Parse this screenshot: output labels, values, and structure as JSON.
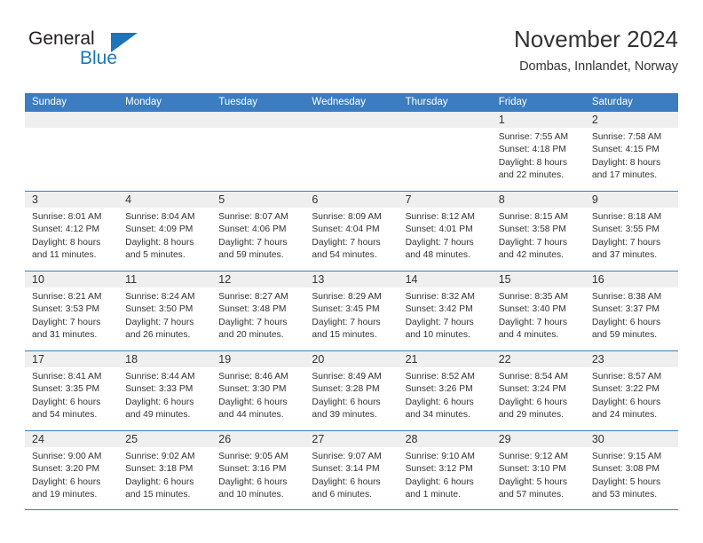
{
  "logo": {
    "primary_text": "General",
    "secondary_text": "Blue",
    "primary_color": "#231f20",
    "accent_color": "#1b75bb"
  },
  "header": {
    "title": "November 2024",
    "subtitle": "Dombas, Innlandet, Norway"
  },
  "theme": {
    "header_band_color": "#3b7dc0",
    "day_band_color": "#efefef",
    "text_color": "#333333"
  },
  "weekday_headers": [
    "Sunday",
    "Monday",
    "Tuesday",
    "Wednesday",
    "Thursday",
    "Friday",
    "Saturday"
  ],
  "weeks": [
    {
      "days": [
        {
          "num": "",
          "empty": true,
          "sunrise": "",
          "sunset": "",
          "daylight1": "",
          "daylight2": ""
        },
        {
          "num": "",
          "empty": true,
          "sunrise": "",
          "sunset": "",
          "daylight1": "",
          "daylight2": ""
        },
        {
          "num": "",
          "empty": true,
          "sunrise": "",
          "sunset": "",
          "daylight1": "",
          "daylight2": ""
        },
        {
          "num": "",
          "empty": true,
          "sunrise": "",
          "sunset": "",
          "daylight1": "",
          "daylight2": ""
        },
        {
          "num": "",
          "empty": true,
          "sunrise": "",
          "sunset": "",
          "daylight1": "",
          "daylight2": ""
        },
        {
          "num": "1",
          "empty": false,
          "sunrise": "Sunrise: 7:55 AM",
          "sunset": "Sunset: 4:18 PM",
          "daylight1": "Daylight: 8 hours",
          "daylight2": "and 22 minutes."
        },
        {
          "num": "2",
          "empty": false,
          "sunrise": "Sunrise: 7:58 AM",
          "sunset": "Sunset: 4:15 PM",
          "daylight1": "Daylight: 8 hours",
          "daylight2": "and 17 minutes."
        }
      ]
    },
    {
      "days": [
        {
          "num": "3",
          "empty": false,
          "sunrise": "Sunrise: 8:01 AM",
          "sunset": "Sunset: 4:12 PM",
          "daylight1": "Daylight: 8 hours",
          "daylight2": "and 11 minutes."
        },
        {
          "num": "4",
          "empty": false,
          "sunrise": "Sunrise: 8:04 AM",
          "sunset": "Sunset: 4:09 PM",
          "daylight1": "Daylight: 8 hours",
          "daylight2": "and 5 minutes."
        },
        {
          "num": "5",
          "empty": false,
          "sunrise": "Sunrise: 8:07 AM",
          "sunset": "Sunset: 4:06 PM",
          "daylight1": "Daylight: 7 hours",
          "daylight2": "and 59 minutes."
        },
        {
          "num": "6",
          "empty": false,
          "sunrise": "Sunrise: 8:09 AM",
          "sunset": "Sunset: 4:04 PM",
          "daylight1": "Daylight: 7 hours",
          "daylight2": "and 54 minutes."
        },
        {
          "num": "7",
          "empty": false,
          "sunrise": "Sunrise: 8:12 AM",
          "sunset": "Sunset: 4:01 PM",
          "daylight1": "Daylight: 7 hours",
          "daylight2": "and 48 minutes."
        },
        {
          "num": "8",
          "empty": false,
          "sunrise": "Sunrise: 8:15 AM",
          "sunset": "Sunset: 3:58 PM",
          "daylight1": "Daylight: 7 hours",
          "daylight2": "and 42 minutes."
        },
        {
          "num": "9",
          "empty": false,
          "sunrise": "Sunrise: 8:18 AM",
          "sunset": "Sunset: 3:55 PM",
          "daylight1": "Daylight: 7 hours",
          "daylight2": "and 37 minutes."
        }
      ]
    },
    {
      "days": [
        {
          "num": "10",
          "empty": false,
          "sunrise": "Sunrise: 8:21 AM",
          "sunset": "Sunset: 3:53 PM",
          "daylight1": "Daylight: 7 hours",
          "daylight2": "and 31 minutes."
        },
        {
          "num": "11",
          "empty": false,
          "sunrise": "Sunrise: 8:24 AM",
          "sunset": "Sunset: 3:50 PM",
          "daylight1": "Daylight: 7 hours",
          "daylight2": "and 26 minutes."
        },
        {
          "num": "12",
          "empty": false,
          "sunrise": "Sunrise: 8:27 AM",
          "sunset": "Sunset: 3:48 PM",
          "daylight1": "Daylight: 7 hours",
          "daylight2": "and 20 minutes."
        },
        {
          "num": "13",
          "empty": false,
          "sunrise": "Sunrise: 8:29 AM",
          "sunset": "Sunset: 3:45 PM",
          "daylight1": "Daylight: 7 hours",
          "daylight2": "and 15 minutes."
        },
        {
          "num": "14",
          "empty": false,
          "sunrise": "Sunrise: 8:32 AM",
          "sunset": "Sunset: 3:42 PM",
          "daylight1": "Daylight: 7 hours",
          "daylight2": "and 10 minutes."
        },
        {
          "num": "15",
          "empty": false,
          "sunrise": "Sunrise: 8:35 AM",
          "sunset": "Sunset: 3:40 PM",
          "daylight1": "Daylight: 7 hours",
          "daylight2": "and 4 minutes."
        },
        {
          "num": "16",
          "empty": false,
          "sunrise": "Sunrise: 8:38 AM",
          "sunset": "Sunset: 3:37 PM",
          "daylight1": "Daylight: 6 hours",
          "daylight2": "and 59 minutes."
        }
      ]
    },
    {
      "days": [
        {
          "num": "17",
          "empty": false,
          "sunrise": "Sunrise: 8:41 AM",
          "sunset": "Sunset: 3:35 PM",
          "daylight1": "Daylight: 6 hours",
          "daylight2": "and 54 minutes."
        },
        {
          "num": "18",
          "empty": false,
          "sunrise": "Sunrise: 8:44 AM",
          "sunset": "Sunset: 3:33 PM",
          "daylight1": "Daylight: 6 hours",
          "daylight2": "and 49 minutes."
        },
        {
          "num": "19",
          "empty": false,
          "sunrise": "Sunrise: 8:46 AM",
          "sunset": "Sunset: 3:30 PM",
          "daylight1": "Daylight: 6 hours",
          "daylight2": "and 44 minutes."
        },
        {
          "num": "20",
          "empty": false,
          "sunrise": "Sunrise: 8:49 AM",
          "sunset": "Sunset: 3:28 PM",
          "daylight1": "Daylight: 6 hours",
          "daylight2": "and 39 minutes."
        },
        {
          "num": "21",
          "empty": false,
          "sunrise": "Sunrise: 8:52 AM",
          "sunset": "Sunset: 3:26 PM",
          "daylight1": "Daylight: 6 hours",
          "daylight2": "and 34 minutes."
        },
        {
          "num": "22",
          "empty": false,
          "sunrise": "Sunrise: 8:54 AM",
          "sunset": "Sunset: 3:24 PM",
          "daylight1": "Daylight: 6 hours",
          "daylight2": "and 29 minutes."
        },
        {
          "num": "23",
          "empty": false,
          "sunrise": "Sunrise: 8:57 AM",
          "sunset": "Sunset: 3:22 PM",
          "daylight1": "Daylight: 6 hours",
          "daylight2": "and 24 minutes."
        }
      ]
    },
    {
      "days": [
        {
          "num": "24",
          "empty": false,
          "sunrise": "Sunrise: 9:00 AM",
          "sunset": "Sunset: 3:20 PM",
          "daylight1": "Daylight: 6 hours",
          "daylight2": "and 19 minutes."
        },
        {
          "num": "25",
          "empty": false,
          "sunrise": "Sunrise: 9:02 AM",
          "sunset": "Sunset: 3:18 PM",
          "daylight1": "Daylight: 6 hours",
          "daylight2": "and 15 minutes."
        },
        {
          "num": "26",
          "empty": false,
          "sunrise": "Sunrise: 9:05 AM",
          "sunset": "Sunset: 3:16 PM",
          "daylight1": "Daylight: 6 hours",
          "daylight2": "and 10 minutes."
        },
        {
          "num": "27",
          "empty": false,
          "sunrise": "Sunrise: 9:07 AM",
          "sunset": "Sunset: 3:14 PM",
          "daylight1": "Daylight: 6 hours",
          "daylight2": "and 6 minutes."
        },
        {
          "num": "28",
          "empty": false,
          "sunrise": "Sunrise: 9:10 AM",
          "sunset": "Sunset: 3:12 PM",
          "daylight1": "Daylight: 6 hours",
          "daylight2": "and 1 minute."
        },
        {
          "num": "29",
          "empty": false,
          "sunrise": "Sunrise: 9:12 AM",
          "sunset": "Sunset: 3:10 PM",
          "daylight1": "Daylight: 5 hours",
          "daylight2": "and 57 minutes."
        },
        {
          "num": "30",
          "empty": false,
          "sunrise": "Sunrise: 9:15 AM",
          "sunset": "Sunset: 3:08 PM",
          "daylight1": "Daylight: 5 hours",
          "daylight2": "and 53 minutes."
        }
      ]
    }
  ]
}
